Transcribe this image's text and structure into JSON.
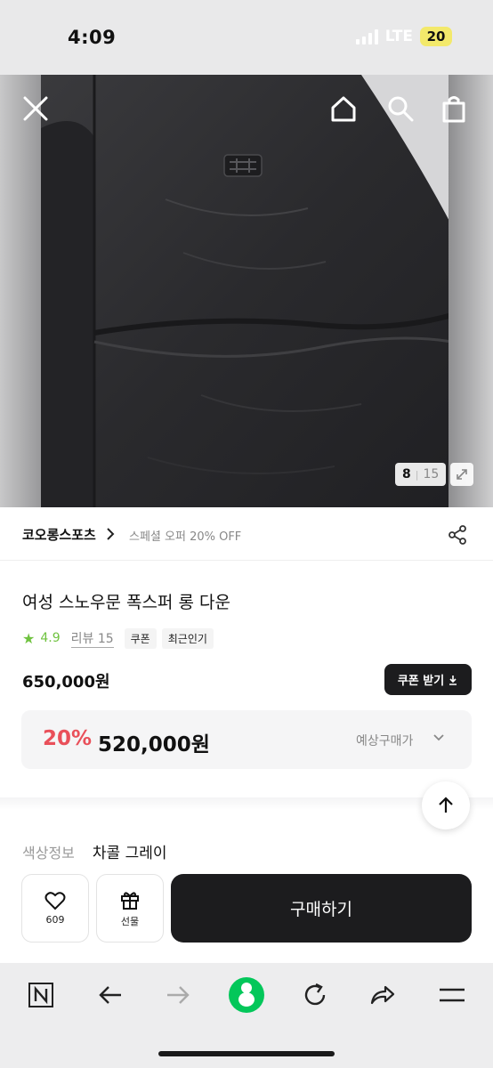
{
  "status_bar": {
    "time": "4:09",
    "network": "LTE",
    "battery": "20"
  },
  "hero": {
    "page_current": "8",
    "page_total": "15"
  },
  "brand": {
    "name": "코오롱스포츠",
    "offer": "스페셜 오퍼 20% OFF"
  },
  "product": {
    "title": "여성 스노우문 폭스퍼 롱 다운",
    "rating": "4.9",
    "review_label": "리뷰 15",
    "tags": [
      "쿠폰",
      "최근인기"
    ],
    "price": "650,000원",
    "coupon_button": "쿠폰 받기"
  },
  "discount": {
    "rate": "20%",
    "price": "520,000원",
    "label": "예상구매가"
  },
  "option": {
    "label": "색상정보",
    "value": "차콜 그레이"
  },
  "actions": {
    "wish_count": "609",
    "gift_label": "선물",
    "buy_label": "구매하기"
  },
  "colors": {
    "accent_green": "#6fc23f",
    "discount_red": "#e9505a",
    "dark_button": "#1c1c1e",
    "naver_green": "#03c75a"
  },
  "icons": [
    "close-icon",
    "home-icon",
    "search-icon",
    "shopping-bag-icon",
    "expand-icon",
    "chevron-right-icon",
    "share-icon",
    "star-icon",
    "download-icon",
    "chevron-down-icon",
    "arrow-up-icon",
    "heart-icon",
    "gift-icon",
    "naver-n-icon",
    "back-arrow-icon",
    "forward-arrow-icon",
    "naver-green-dot-icon",
    "refresh-icon",
    "share-arrow-icon",
    "menu-icon"
  ]
}
